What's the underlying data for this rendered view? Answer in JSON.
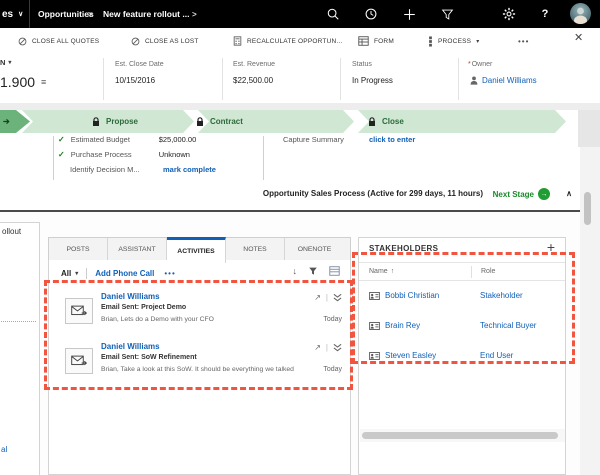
{
  "topbar": {
    "app_label": "es",
    "sep": ">",
    "items": [
      {
        "label": "Opportunities"
      },
      {
        "label": "New feature rollout ..."
      }
    ]
  },
  "command_bar": {
    "close_all_quotes": "CLOSE ALL QUOTES",
    "close_as_lost": "CLOSE AS LOST",
    "recalculate": "RECALCULATE OPPORTUN...",
    "form": "FORM",
    "process": "PROCESS",
    "overflow": "•••",
    "close": "✕"
  },
  "header": {
    "partial_top": "N",
    "partial_value": "1.900",
    "owner_required_mark": "*",
    "fields": [
      {
        "label": "Est. Close Date",
        "value": "10/15/2016"
      },
      {
        "label": "Est. Revenue",
        "value": "$22,500.00"
      },
      {
        "label": "Status",
        "value": "In Progress"
      },
      {
        "label": "Owner",
        "value": "Daniel Williams"
      }
    ]
  },
  "process": {
    "stages": [
      {
        "label": "Propose"
      },
      {
        "label": "Contract"
      },
      {
        "label": "Close"
      }
    ],
    "details": [
      {
        "label": "Estimated Budget",
        "value": "$25,000.00"
      },
      {
        "label": "Purchase Process",
        "value": "Unknown"
      },
      {
        "label": "Identify Decision M...",
        "value": "mark complete"
      }
    ],
    "capture": {
      "label": "Capture Summary",
      "value": "click to enter"
    },
    "status_text": "Opportunity Sales Process (Active for 299 days, 11 hours)",
    "next_stage": "Next Stage"
  },
  "left_panel": {
    "partial_text": "ollout",
    "partial_link": "al"
  },
  "activities": {
    "active_tab": "ACTIVITIES",
    "tabs": [
      {
        "label": "POSTS"
      },
      {
        "label": "ASSISTANT"
      },
      {
        "label": "ACTIVITIES"
      },
      {
        "label": "NOTES"
      },
      {
        "label": "ONENOTE"
      }
    ],
    "toolbar": {
      "filter": "All",
      "add": "Add Phone Call",
      "more": "•••"
    },
    "items": [
      {
        "from": "Daniel Williams",
        "subject": "Email Sent: Project Demo",
        "preview": "Brian, Lets do a Demo with your CFO",
        "date": "Today"
      },
      {
        "from": "Daniel Williams",
        "subject": "Email Sent: SoW Refinement",
        "preview": "Brian, Take a look at this SoW. It should be everything we talked",
        "date": "Today"
      }
    ]
  },
  "stakeholders": {
    "title": "STAKEHOLDERS",
    "add": "+",
    "columns": {
      "name": "Name",
      "role": "Role"
    },
    "rows": [
      {
        "name": "Bobbi Christian",
        "role": "Stakeholder"
      },
      {
        "name": "Brain Rey",
        "role": "Technical Buyer"
      },
      {
        "name": "Steven Easley",
        "role": "End User"
      }
    ]
  },
  "glyphs": {
    "chevron_down": "∨",
    "caret_down": "▾",
    "lines": "≡",
    "check": "✓",
    "arrow_right": "➔",
    "circle_arrow": "→",
    "collapse": "∧",
    "arrow_down": "↓",
    "sort_asc": "↑",
    "open_out": "↗",
    "pipe": "|"
  },
  "colors": {
    "topbar_bg": "#000000",
    "accent_blue": "#1160b7",
    "stage_green_light": "#cfe7d3",
    "stage_green_dark": "#6cb27b",
    "next_stage_green": "#1b8a2a",
    "annotation_red": "#f1543f"
  }
}
